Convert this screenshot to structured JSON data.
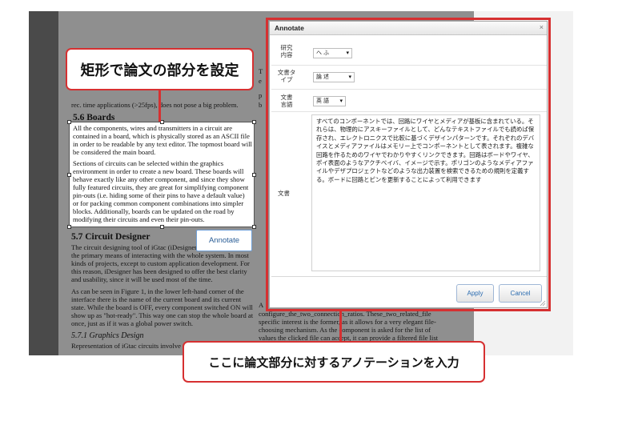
{
  "paper": {
    "intro_line": "rec. time applications (>25fps), does not pose a big problem.",
    "right_col_top": [
      "T",
      "e",
      "p",
      "b"
    ],
    "section_boards": {
      "heading": "5.6 Boards",
      "para1": [
        "All the components, wires and transmitters in a circuit are",
        "contained in a board, which is physically stored as an ASCII file",
        "in order to be readable by any text editor. The topmost board will",
        "be considered the main board."
      ],
      "para2": [
        "Sections of circuits can be selected within the graphics",
        "environment in order to create a new board. These boards will",
        "behave exactly like any other component, and since they show",
        "fully featured circuits, they are great for simplifying component",
        "pin-outs (i.e. hiding some of their pins to have a default value)",
        "or for packing common component combinations into simpler",
        "blocks. Additionally, boards can be updated on the road by",
        "modifying their circuits and even their pin-outs."
      ]
    },
    "section_designer": {
      "heading": "5.7 Circuit Designer",
      "para1": [
        "The circuit designing tool of iGtac (iDesigner) is",
        "the primary means of interacting with the whole system. In most",
        "kinds of projects, except to custom application development. For",
        "this reason, iDesigner has been designed to offer the best clarity",
        "and usability, since it will be used most of the time."
      ],
      "para2": [
        "As can be seen in Figure 1, in the lower left-hand corner of the",
        "interface there is the name of the current board and its current",
        "state. While the board is OFF, every component switched ON will",
        "show up as \"hot-ready\". This way one can stop the whole board at",
        "once, just as if it was a global power switch."
      ]
    },
    "subsection_graphics": {
      "heading": "5.7.1  Graphics Design",
      "line": "Representation of iGtac circuits involve"
    },
    "right_col_bottom": [
      "A",
      "configure_the_two_connection_ratios. These_two_related_file",
      "specific interest is the former, as it allows for a very elegant file-",
      "choosing mechanism. As the component is asked for the list of",
      "values the clicked file can accept, it can provide a filtered file list"
    ]
  },
  "annotate_trigger": {
    "label": "Annotate"
  },
  "callouts": {
    "selection": "矩形で論文の部分を設定",
    "annotation": "ここに論文部分に対するアノテーションを入力"
  },
  "dialog": {
    "title": "Annotate",
    "close_glyph": "×",
    "fields": [
      {
        "label_lines": [
          "研究",
          "内容"
        ],
        "value": "へ ふ"
      },
      {
        "label_lines": [
          "文書タ",
          "イプ"
        ],
        "value": "論 述"
      },
      {
        "label_lines": [
          "文書",
          "言語"
        ],
        "value": "英 語"
      }
    ],
    "text_label": "文書",
    "text_value": "すべてのコンポーネントでは、回路にワイヤとメディアが基板に含まれている。それらは、物理的にアスキーファイルとして、どんなテキストファイルでも読めば保存され、エレクトロニクスで比較に基づくデザインパターンです。それぞれのデバイスとメディアファイルはメモリー上でコンポーネントとして表されます。複雑な回路を作るためのワイヤでわかりやすくリンクできます。回路はボードやワイヤ、ポイ表面のようなアクチベイバ、イメージで示す。ポリゴンのようなメディアファイルやデザプロジェクトなどのような出力装置を検索できるための規則を定義する。ボードに回路とピンを更新することによって利用できます",
    "buttons": {
      "apply": "Apply",
      "cancel": "Cancel"
    }
  },
  "colors": {
    "callout_border": "#d63031",
    "link_blue": "#2b6cb0"
  }
}
